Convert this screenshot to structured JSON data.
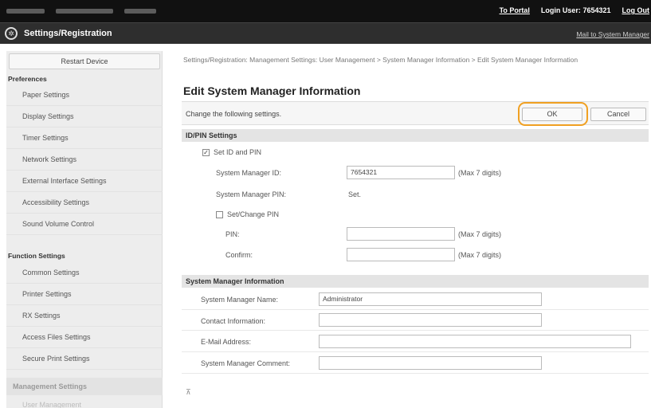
{
  "topbar": {
    "portal_link": "To Portal",
    "login_label": "Login User:",
    "login_user": "7654321",
    "logout": "Log Out"
  },
  "titlebar": {
    "title": "Settings/Registration",
    "mail_link": "Mail to System Manager"
  },
  "sidebar": {
    "restart_button": "Restart Device",
    "group_preferences": "Preferences",
    "preferences_items": [
      "Paper Settings",
      "Display Settings",
      "Timer Settings",
      "Network Settings",
      "External Interface Settings",
      "Accessibility Settings",
      "Sound Volume Control"
    ],
    "group_function": "Function Settings",
    "function_items": [
      "Common Settings",
      "Printer Settings",
      "RX Settings",
      "Access Files Settings",
      "Secure Print Settings"
    ],
    "group_management": "Management Settings",
    "management_items": [
      "User Management"
    ]
  },
  "main": {
    "breadcrumb": "Settings/Registration: Management Settings: User Management > System Manager Information > Edit System Manager Information",
    "page_title": "Edit System Manager Information",
    "description": "Change the following settings.",
    "ok_button": "OK",
    "cancel_button": "Cancel",
    "id_pin_section": {
      "header": "ID/PIN Settings",
      "set_id_pin_label": "Set ID and PIN",
      "set_id_pin_checked": true,
      "manager_id_label": "System Manager ID:",
      "manager_id_value": "7654321",
      "manager_id_hint": "(Max 7 digits)",
      "manager_pin_label": "System Manager PIN:",
      "manager_pin_value": "Set.",
      "change_pin_label": "Set/Change PIN",
      "change_pin_checked": false,
      "pin_label": "PIN:",
      "pin_value": "",
      "pin_hint": "(Max 7 digits)",
      "confirm_label": "Confirm:",
      "confirm_value": "",
      "confirm_hint": "(Max 7 digits)"
    },
    "info_section": {
      "header": "System Manager Information",
      "name_label": "System Manager Name:",
      "name_value": "Administrator",
      "contact_label": "Contact Information:",
      "contact_value": "",
      "email_label": "E-Mail Address:",
      "email_value": "",
      "comment_label": "System Manager Comment:",
      "comment_value": ""
    },
    "top_link": "⊼"
  },
  "colors": {
    "topbar_bg": "#111111",
    "titlebar_bg": "#2e2e2e",
    "ok_highlight": "#f0a022",
    "sidebar_bg": "#ededed",
    "section_header_bg": "#e4e4e4"
  }
}
